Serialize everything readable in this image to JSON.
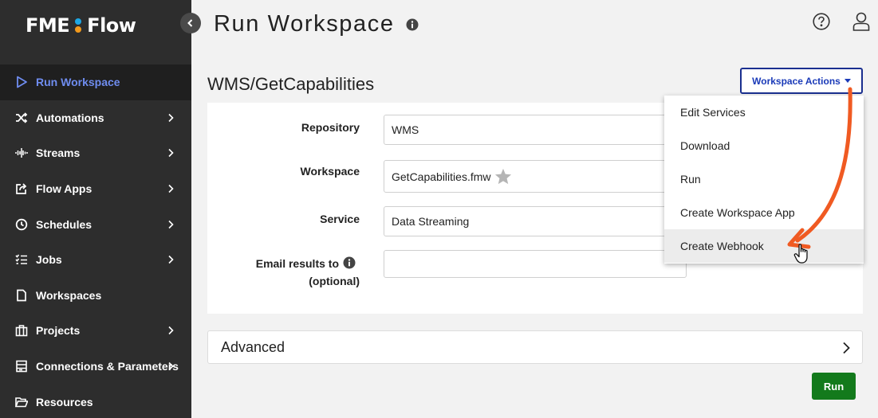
{
  "app": {
    "logo_left": "FME",
    "logo_right": "Flow"
  },
  "header": {
    "title": "Run Workspace"
  },
  "sidebar": {
    "items": [
      {
        "label": "Run Workspace",
        "icon": "play-icon",
        "active": true,
        "has_children": false
      },
      {
        "label": "Automations",
        "icon": "shuffle-icon",
        "has_children": true
      },
      {
        "label": "Streams",
        "icon": "waveform-icon",
        "has_children": true
      },
      {
        "label": "Flow Apps",
        "icon": "share-icon",
        "has_children": true
      },
      {
        "label": "Schedules",
        "icon": "clock-icon",
        "has_children": true
      },
      {
        "label": "Jobs",
        "icon": "checklist-icon",
        "has_children": true
      },
      {
        "label": "Workspaces",
        "icon": "file-icon",
        "has_children": false
      },
      {
        "label": "Projects",
        "icon": "briefcase-icon",
        "has_children": true
      },
      {
        "label": "Connections & Parameters",
        "icon": "server-icon",
        "has_children": true
      },
      {
        "label": "Resources",
        "icon": "folder-open-icon",
        "has_children": false
      }
    ]
  },
  "workspace": {
    "title": "WMS/GetCapabilities",
    "actions_label": "Workspace Actions"
  },
  "form": {
    "repository_label": "Repository",
    "repository_value": "WMS",
    "workspace_label": "Workspace",
    "workspace_value": "GetCapabilities.fmw",
    "service_label": "Service",
    "service_value": "Data Streaming",
    "email_label": "Email results to",
    "email_optional": "(optional)",
    "email_value": ""
  },
  "advanced": {
    "label": "Advanced"
  },
  "run_label": "Run",
  "menu": {
    "items": [
      "Edit Services",
      "Download",
      "Run",
      "Create Workspace App",
      "Create Webhook"
    ],
    "hovered": "Create Webhook"
  },
  "colors": {
    "sidebar_bg": "#2d2d2d",
    "active_item": "#6f8df0",
    "accent_blue": "#1a3ab8",
    "run_green": "#137a1c",
    "annotation_arrow": "#f05a22"
  }
}
